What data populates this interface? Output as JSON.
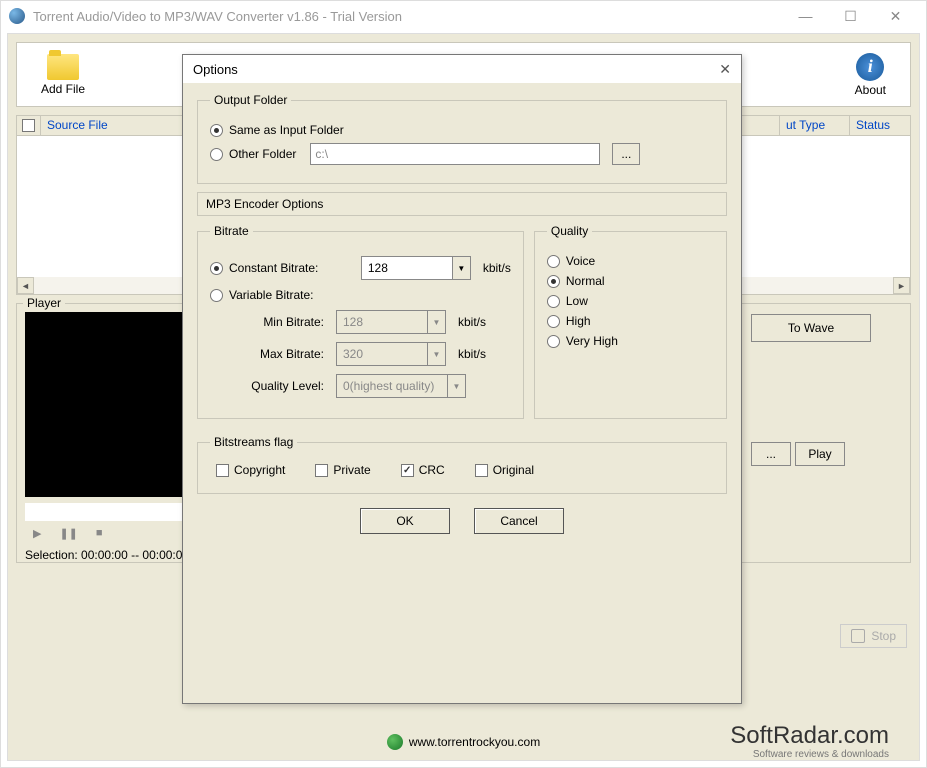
{
  "window": {
    "title": "Torrent Audio/Video to MP3/WAV Converter v1.86 - Trial Version"
  },
  "toolbar": {
    "add_file": "Add File",
    "about": "About"
  },
  "file_list": {
    "col_source": "Source File",
    "col_type": "ut Type",
    "col_status": "Status"
  },
  "player": {
    "group_label": "Player",
    "selection": "Selection: 00:00:00 -- 00:00:00"
  },
  "right": {
    "to_wave": "To Wave",
    "browse": "...",
    "play": "Play",
    "stop": "Stop"
  },
  "footer": {
    "url": "www.torrentrockyou.com",
    "brand": "SoftRadar.com",
    "brand_sub": "Software reviews & downloads"
  },
  "dialog": {
    "title": "Options",
    "output": {
      "legend": "Output Folder",
      "same": "Same as Input Folder",
      "other": "Other Folder",
      "path": "c:\\",
      "browse": "..."
    },
    "encoder_header": "MP3 Encoder Options",
    "bitrate": {
      "legend": "Bitrate",
      "constant": "Constant Bitrate:",
      "variable": "Variable Bitrate:",
      "cbr_value": "128",
      "min_label": "Min Bitrate:",
      "min_value": "128",
      "max_label": "Max Bitrate:",
      "max_value": "320",
      "quality_label": "Quality Level:",
      "quality_value": "0(highest quality)",
      "unit": "kbit/s"
    },
    "quality": {
      "legend": "Quality",
      "voice": "Voice",
      "normal": "Normal",
      "low": "Low",
      "high": "High",
      "very_high": "Very High"
    },
    "flags": {
      "legend": "Bitstreams flag",
      "copyright": "Copyright",
      "private": "Private",
      "crc": "CRC",
      "original": "Original"
    },
    "ok": "OK",
    "cancel": "Cancel"
  }
}
